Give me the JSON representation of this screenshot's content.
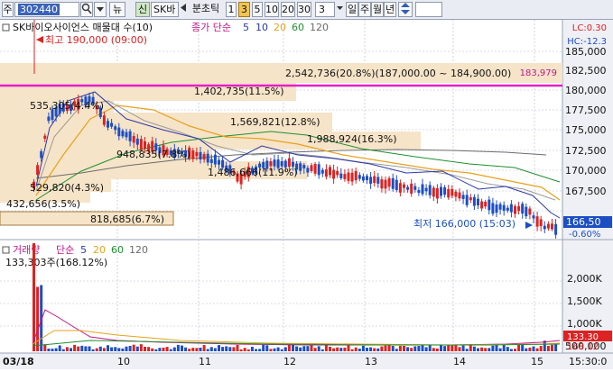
{
  "toolbar": {
    "market": "주",
    "code": "302440",
    "search_icon": "magnifier-icon",
    "dropdown_icon": "dropdown-icon",
    "news_label": "뉴",
    "credit_label": "신",
    "stock_name": "SK바",
    "nav_left_icon": "triangle-left-icon",
    "period_mode": "분초틱",
    "periods": [
      "1",
      "3",
      "5",
      "10",
      "20",
      "30"
    ],
    "selected_period": "3",
    "repeat_value": "3",
    "calendar_periods": [
      "일",
      "주",
      "월",
      "년"
    ],
    "updown_icon": "updown-arrow-icon",
    "colors": {
      "selected": "#f3c453",
      "toolbar_bg": "#e9ecf3"
    }
  },
  "price_panel": {
    "title": "SK바이오사이언스 매물대 수(10)",
    "ma_label": "종가 단순",
    "ma_periods": [
      "5",
      "10",
      "20",
      "60",
      "120"
    ],
    "ma_colors": [
      "#2d39a8",
      "#9a9a9a",
      "#e7a21b",
      "#1f8f2f",
      "#6b6b6b"
    ],
    "corner_lc": "LC:0.30",
    "corner_hc": "HC:-12.3",
    "y_ticks": [
      "185,000",
      "182,500",
      "180,000",
      "177,500",
      "175,000",
      "172,500",
      "170,000",
      "167,500"
    ],
    "last_price_label": "166,50",
    "last_change_label": "-0.60%",
    "high_note": "최고 190,000 (09:00)",
    "low_note": "최저 166,000 (15:03)",
    "magenta_line_label": "183,979",
    "volume_profile_labels": [
      "2,542,736(20.8%)(187,000.00 ~ 184,900.00)",
      "1,402,735(11.5%)",
      "535,305(4.4%)",
      "1,569,821(12.8%)",
      "1,988,924(16.3%)",
      "948,835(7.8%)",
      "1,486,666(11.9%)",
      "529,820(4.3%)",
      "432,656(3.5%)",
      "818,685(6.7%)"
    ],
    "colors": {
      "up": "#dd2222",
      "down": "#1c4ec4",
      "profile": "#f6e4c8",
      "magenta": "#e320c8"
    }
  },
  "volume_panel": {
    "title": "거래량",
    "ma_label": "단순",
    "ma_periods": [
      "5",
      "20",
      "60",
      "120"
    ],
    "value_label": "133,303주(168.12%)",
    "y_ticks": [
      "2,000K",
      "1,500K",
      "1,000K",
      "500,000"
    ],
    "last_volume_label": "133.30",
    "last_ratio_label": "168.12"
  },
  "x_axis": {
    "labels": [
      "03/18",
      "10",
      "11",
      "12",
      "13",
      "14",
      "15",
      "15:30:0"
    ]
  }
}
